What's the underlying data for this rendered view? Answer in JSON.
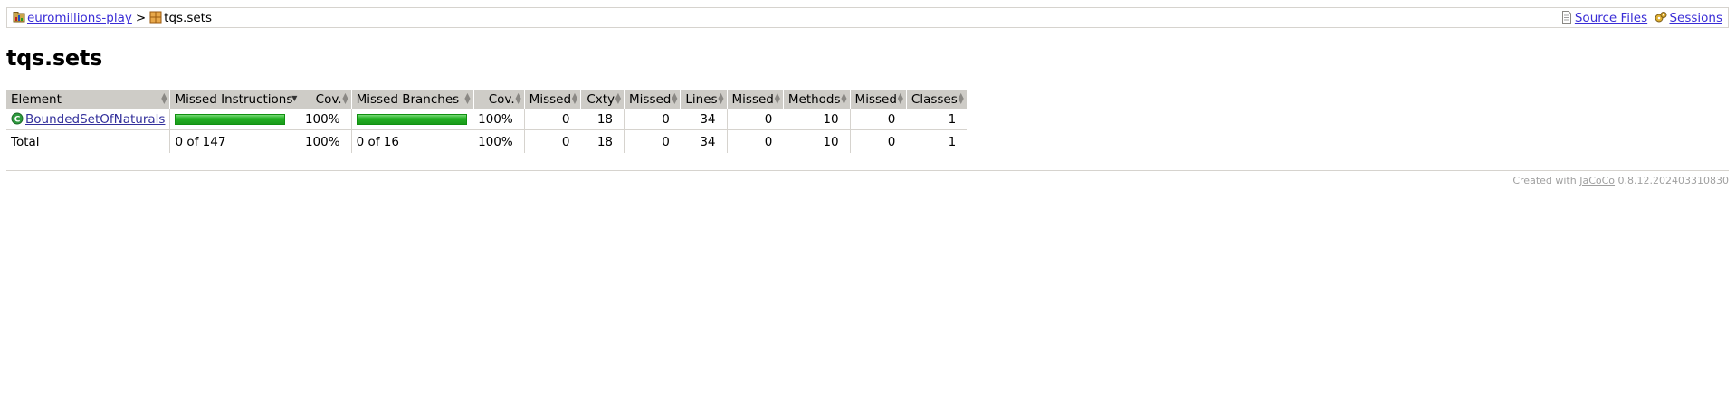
{
  "breadcrumb": {
    "project_link": "euromillions-play",
    "separator": ">",
    "current": "tqs.sets",
    "source_files": "Source Files",
    "sessions": "Sessions"
  },
  "page_title": "tqs.sets",
  "table": {
    "headers": [
      "Element",
      "Missed Instructions",
      "Cov.",
      "Missed Branches",
      "Cov.",
      "Missed",
      "Cxty",
      "Missed",
      "Lines",
      "Missed",
      "Methods",
      "Missed",
      "Classes"
    ],
    "rows": [
      {
        "element": "BoundedSetOfNaturals",
        "instructions_covered_fraction": 1.0,
        "instructions_cov": "100%",
        "branches_covered_fraction": 1.0,
        "branches_cov": "100%",
        "missed_cxty": "0",
        "cxty": "18",
        "missed_lines": "0",
        "lines": "34",
        "missed_methods": "0",
        "methods": "10",
        "missed_classes": "0",
        "classes": "1"
      }
    ],
    "total": {
      "label": "Total",
      "instructions": "0 of 147",
      "instructions_cov": "100%",
      "branches": "0 of 16",
      "branches_cov": "100%",
      "missed_cxty": "0",
      "cxty": "18",
      "missed_lines": "0",
      "lines": "34",
      "missed_methods": "0",
      "methods": "10",
      "missed_classes": "0",
      "classes": "1"
    }
  },
  "footer": {
    "prefix": "Created with",
    "tool": "JaCoCo",
    "version": "0.8.12.202403310830"
  },
  "colors": {
    "header_bg": "#ceccc7",
    "bar_green": "#23b123",
    "link": "#3a2dd6"
  }
}
